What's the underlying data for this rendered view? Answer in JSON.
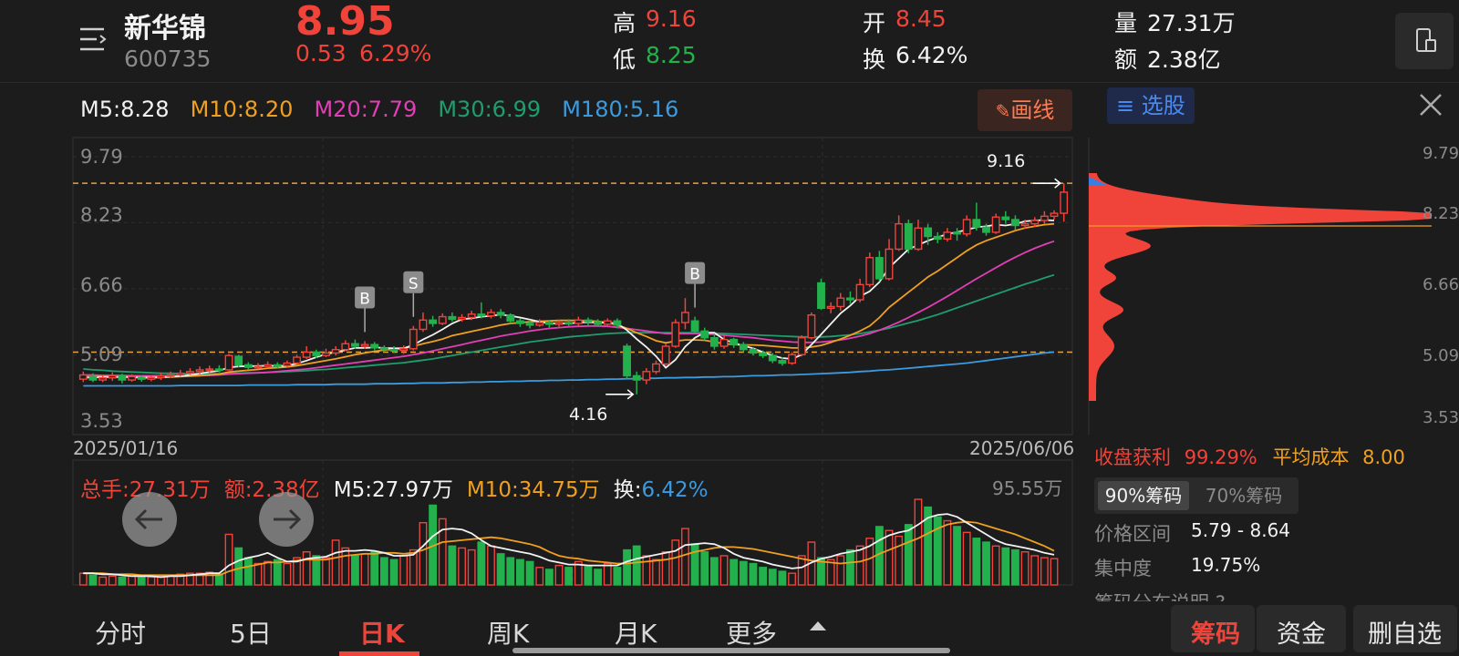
{
  "stock": {
    "name": "新华锦",
    "code": "600735",
    "price": "8.95",
    "change": "0.53",
    "change_pct": "6.29%",
    "high_label": "高",
    "high": "9.16",
    "low_label": "低",
    "low": "8.25",
    "open_label": "开",
    "open": "8.45",
    "turnover_label": "换",
    "turnover": "6.42%",
    "volume_label": "量",
    "volume": "27.31万",
    "amount_label": "额",
    "amount": "2.38亿"
  },
  "ma_legend": {
    "m5": "M5:8.28",
    "m10": "M10:8.20",
    "m20": "M20:7.79",
    "m30": "M30:6.99",
    "m180": "M180:5.16"
  },
  "draw_button": "画线",
  "chart_data": {
    "type": "candlestick",
    "y_ticks": [
      "9.79",
      "8.23",
      "6.66",
      "5.09",
      "3.53"
    ],
    "ylim": [
      3.53,
      9.79
    ],
    "date_start": "2025/01/16",
    "date_end": "2025/06/06",
    "max_annotation": "9.16",
    "min_annotation": "4.16",
    "max_value": 9.16,
    "min_value": 4.16,
    "ref_lines": [
      9.16,
      5.16
    ],
    "markers": [
      {
        "label": "B",
        "index": 29
      },
      {
        "label": "S",
        "index": 34
      },
      {
        "label": "B",
        "index": 63
      }
    ],
    "candles": [
      [
        4.52,
        4.62,
        4.7,
        4.45
      ],
      [
        4.58,
        4.5,
        4.66,
        4.45
      ],
      [
        4.5,
        4.55,
        4.62,
        4.45
      ],
      [
        4.55,
        4.6,
        4.68,
        4.48
      ],
      [
        4.6,
        4.5,
        4.65,
        4.42
      ],
      [
        4.5,
        4.58,
        4.64,
        4.46
      ],
      [
        4.56,
        4.52,
        4.62,
        4.46
      ],
      [
        4.52,
        4.56,
        4.62,
        4.47
      ],
      [
        4.56,
        4.6,
        4.68,
        4.5
      ],
      [
        4.6,
        4.62,
        4.7,
        4.55
      ],
      [
        4.62,
        4.66,
        4.74,
        4.58
      ],
      [
        4.66,
        4.7,
        4.78,
        4.62
      ],
      [
        4.7,
        4.74,
        4.82,
        4.64
      ],
      [
        4.74,
        4.76,
        4.84,
        4.68
      ],
      [
        4.76,
        4.74,
        4.85,
        4.68
      ],
      [
        4.74,
        5.08,
        5.12,
        4.72
      ],
      [
        5.06,
        4.86,
        5.1,
        4.8
      ],
      [
        4.86,
        4.8,
        4.92,
        4.74
      ],
      [
        4.8,
        4.82,
        4.9,
        4.76
      ],
      [
        4.82,
        4.86,
        4.94,
        4.78
      ],
      [
        4.86,
        4.84,
        4.92,
        4.78
      ],
      [
        4.84,
        4.9,
        4.96,
        4.8
      ],
      [
        4.9,
        5.04,
        5.1,
        4.86
      ],
      [
        5.04,
        5.16,
        5.3,
        5.0
      ],
      [
        5.16,
        5.08,
        5.22,
        5.02
      ],
      [
        5.08,
        5.14,
        5.24,
        5.04
      ],
      [
        5.14,
        5.22,
        5.3,
        5.08
      ],
      [
        5.22,
        5.36,
        5.44,
        5.18
      ],
      [
        5.36,
        5.3,
        5.46,
        5.24
      ],
      [
        5.3,
        5.34,
        5.42,
        5.24
      ],
      [
        5.34,
        5.26,
        5.4,
        5.2
      ],
      [
        5.26,
        5.22,
        5.32,
        5.16
      ],
      [
        5.22,
        5.2,
        5.3,
        5.14
      ],
      [
        5.2,
        5.24,
        5.32,
        5.12
      ],
      [
        5.24,
        5.7,
        5.78,
        5.2
      ],
      [
        5.7,
        5.92,
        6.1,
        5.64
      ],
      [
        5.92,
        5.84,
        6.02,
        5.76
      ],
      [
        5.84,
        6.0,
        6.08,
        5.8
      ],
      [
        6.0,
        5.94,
        6.1,
        5.88
      ],
      [
        5.94,
        5.98,
        6.06,
        5.88
      ],
      [
        5.98,
        6.06,
        6.14,
        5.92
      ],
      [
        6.06,
        6.02,
        6.34,
        5.96
      ],
      [
        6.02,
        6.1,
        6.18,
        5.96
      ],
      [
        6.1,
        6.04,
        6.18,
        5.96
      ],
      [
        6.04,
        5.9,
        6.08,
        5.84
      ],
      [
        5.9,
        5.84,
        5.96,
        5.76
      ],
      [
        5.84,
        5.8,
        5.92,
        5.72
      ],
      [
        5.8,
        5.86,
        5.94,
        5.76
      ],
      [
        5.86,
        5.82,
        5.92,
        5.74
      ],
      [
        5.82,
        5.86,
        5.92,
        5.76
      ],
      [
        5.86,
        5.84,
        5.94,
        5.78
      ],
      [
        5.84,
        5.92,
        6.0,
        5.78
      ],
      [
        5.92,
        5.88,
        5.98,
        5.8
      ],
      [
        5.88,
        5.82,
        5.94,
        5.76
      ],
      [
        5.82,
        5.9,
        5.96,
        5.78
      ],
      [
        5.9,
        5.8,
        5.96,
        5.72
      ],
      [
        5.3,
        4.6,
        5.36,
        4.52
      ],
      [
        4.6,
        4.5,
        4.7,
        4.16
      ],
      [
        4.5,
        4.7,
        4.78,
        4.4
      ],
      [
        4.7,
        4.88,
        4.96,
        4.64
      ],
      [
        4.88,
        5.3,
        5.36,
        4.84
      ],
      [
        5.3,
        5.86,
        5.94,
        5.26
      ],
      [
        5.86,
        6.1,
        6.44,
        5.7
      ],
      [
        5.9,
        5.66,
        6.0,
        5.6
      ],
      [
        5.66,
        5.5,
        5.74,
        5.44
      ],
      [
        5.5,
        5.3,
        5.6,
        5.22
      ],
      [
        5.3,
        5.46,
        5.56,
        5.24
      ],
      [
        5.46,
        5.34,
        5.5,
        5.26
      ],
      [
        5.34,
        5.22,
        5.4,
        5.16
      ],
      [
        5.22,
        5.14,
        5.28,
        5.08
      ],
      [
        5.14,
        5.08,
        5.2,
        5.02
      ],
      [
        5.08,
        4.96,
        5.14,
        4.9
      ],
      [
        4.96,
        4.9,
        5.04,
        4.84
      ],
      [
        4.9,
        5.1,
        5.16,
        4.86
      ],
      [
        5.1,
        5.5,
        5.56,
        5.06
      ],
      [
        5.5,
        6.04,
        6.1,
        5.46
      ],
      [
        6.8,
        6.2,
        6.9,
        6.16
      ],
      [
        6.2,
        6.24,
        6.34,
        6.08
      ],
      [
        6.24,
        6.44,
        6.56,
        6.14
      ],
      [
        6.44,
        6.4,
        6.6,
        6.3
      ],
      [
        6.4,
        6.76,
        6.9,
        6.34
      ],
      [
        6.76,
        7.4,
        7.52,
        6.7
      ],
      [
        7.4,
        6.9,
        7.56,
        6.84
      ],
      [
        6.9,
        7.6,
        7.84,
        6.86
      ],
      [
        7.6,
        8.2,
        8.4,
        7.56
      ],
      [
        8.2,
        7.6,
        8.3,
        7.5
      ],
      [
        7.6,
        8.1,
        8.3,
        7.56
      ],
      [
        8.1,
        7.9,
        8.2,
        7.7
      ],
      [
        7.9,
        7.84,
        8.0,
        7.74
      ],
      [
        7.84,
        8.0,
        8.1,
        7.78
      ],
      [
        8.0,
        7.96,
        8.1,
        7.8
      ],
      [
        7.96,
        8.3,
        8.4,
        7.9
      ],
      [
        8.3,
        8.12,
        8.7,
        8.04
      ],
      [
        8.12,
        8.0,
        8.2,
        7.92
      ],
      [
        8.0,
        8.36,
        8.44,
        7.96
      ],
      [
        8.36,
        8.3,
        8.5,
        8.2
      ],
      [
        8.3,
        8.16,
        8.4,
        8.06
      ],
      [
        8.16,
        8.2,
        8.3,
        8.08
      ],
      [
        8.2,
        8.28,
        8.36,
        8.12
      ],
      [
        8.28,
        8.38,
        8.5,
        8.2
      ],
      [
        8.38,
        8.45,
        8.52,
        8.3
      ],
      [
        8.45,
        8.95,
        9.16,
        8.25
      ]
    ],
    "ma5": [
      4.56,
      4.56,
      4.57,
      4.57,
      4.57,
      4.57,
      4.55,
      4.56,
      4.56,
      4.58,
      4.59,
      4.62,
      4.65,
      4.69,
      4.72,
      4.8,
      4.82,
      4.83,
      4.83,
      4.84,
      4.83,
      4.84,
      4.89,
      4.96,
      5.04,
      5.11,
      5.16,
      5.21,
      5.26,
      5.26,
      5.27,
      5.26,
      5.25,
      5.25,
      5.33,
      5.46,
      5.57,
      5.7,
      5.84,
      5.94,
      5.96,
      6.0,
      6.02,
      6.05,
      6.02,
      5.98,
      5.93,
      5.88,
      5.84,
      5.84,
      5.84,
      5.86,
      5.87,
      5.86,
      5.86,
      5.84,
      5.68,
      5.47,
      5.28,
      5.06,
      4.79,
      4.98,
      5.29,
      5.5,
      5.62,
      5.62,
      5.46,
      5.38,
      5.31,
      5.25,
      5.16,
      5.08,
      5.02,
      5.0,
      5.1,
      5.34,
      5.58,
      5.83,
      6.08,
      6.26,
      6.48,
      6.6,
      6.82,
      7.16,
      7.38,
      7.6,
      7.7,
      7.8,
      7.88,
      7.96,
      8.0,
      8.06,
      8.12,
      8.14,
      8.18,
      8.16,
      8.2,
      8.26,
      8.28,
      8.29,
      8.28
    ],
    "ma10": [
      4.58,
      4.58,
      4.58,
      4.58,
      4.57,
      4.57,
      4.57,
      4.57,
      4.57,
      4.57,
      4.58,
      4.59,
      4.6,
      4.62,
      4.64,
      4.69,
      4.71,
      4.73,
      4.75,
      4.78,
      4.79,
      4.81,
      4.84,
      4.88,
      4.92,
      4.96,
      5.0,
      5.05,
      5.1,
      5.14,
      5.18,
      5.21,
      5.23,
      5.25,
      5.3,
      5.36,
      5.41,
      5.47,
      5.55,
      5.6,
      5.65,
      5.7,
      5.75,
      5.8,
      5.84,
      5.86,
      5.88,
      5.89,
      5.9,
      5.91,
      5.91,
      5.91,
      5.9,
      5.89,
      5.86,
      5.8,
      5.72,
      5.62,
      5.53,
      5.43,
      5.38,
      5.42,
      5.45,
      5.45,
      5.44,
      5.4,
      5.36,
      5.34,
      5.33,
      5.33,
      5.32,
      5.3,
      5.28,
      5.26,
      5.26,
      5.28,
      5.32,
      5.39,
      5.47,
      5.56,
      5.66,
      5.78,
      5.98,
      6.22,
      6.4,
      6.58,
      6.76,
      6.94,
      7.08,
      7.24,
      7.4,
      7.56,
      7.7,
      7.8,
      7.88,
      7.96,
      8.04,
      8.1,
      8.14,
      8.18,
      8.2
    ],
    "ma20": [
      4.62,
      4.62,
      4.61,
      4.61,
      4.61,
      4.6,
      4.6,
      4.6,
      4.6,
      4.6,
      4.6,
      4.6,
      4.61,
      4.61,
      4.62,
      4.64,
      4.65,
      4.66,
      4.67,
      4.68,
      4.7,
      4.72,
      4.74,
      4.76,
      4.79,
      4.82,
      4.85,
      4.88,
      4.91,
      4.94,
      4.97,
      5.0,
      5.03,
      5.06,
      5.1,
      5.14,
      5.19,
      5.24,
      5.29,
      5.34,
      5.39,
      5.44,
      5.49,
      5.54,
      5.58,
      5.62,
      5.66,
      5.69,
      5.72,
      5.74,
      5.76,
      5.77,
      5.78,
      5.78,
      5.77,
      5.75,
      5.72,
      5.69,
      5.66,
      5.63,
      5.6,
      5.6,
      5.6,
      5.6,
      5.59,
      5.58,
      5.56,
      5.54,
      5.52,
      5.5,
      5.47,
      5.44,
      5.42,
      5.4,
      5.39,
      5.39,
      5.4,
      5.42,
      5.45,
      5.49,
      5.54,
      5.6,
      5.68,
      5.77,
      5.87,
      5.98,
      6.1,
      6.22,
      6.35,
      6.48,
      6.62,
      6.76,
      6.9,
      7.03,
      7.16,
      7.29,
      7.41,
      7.52,
      7.62,
      7.71,
      7.79
    ],
    "ma30": [
      4.76,
      4.74,
      4.73,
      4.71,
      4.7,
      4.69,
      4.68,
      4.67,
      4.66,
      4.66,
      4.65,
      4.65,
      4.65,
      4.65,
      4.65,
      4.66,
      4.66,
      4.67,
      4.67,
      4.68,
      4.69,
      4.7,
      4.71,
      4.72,
      4.74,
      4.75,
      4.77,
      4.79,
      4.81,
      4.83,
      4.85,
      4.87,
      4.89,
      4.91,
      4.94,
      4.97,
      5.0,
      5.04,
      5.08,
      5.12,
      5.16,
      5.2,
      5.24,
      5.28,
      5.32,
      5.36,
      5.4,
      5.43,
      5.46,
      5.49,
      5.52,
      5.54,
      5.56,
      5.58,
      5.6,
      5.61,
      5.62,
      5.62,
      5.62,
      5.62,
      5.62,
      5.62,
      5.62,
      5.62,
      5.62,
      5.61,
      5.6,
      5.59,
      5.58,
      5.57,
      5.56,
      5.55,
      5.54,
      5.53,
      5.52,
      5.52,
      5.52,
      5.53,
      5.55,
      5.57,
      5.6,
      5.64,
      5.68,
      5.73,
      5.79,
      5.85,
      5.91,
      5.98,
      6.05,
      6.13,
      6.21,
      6.29,
      6.37,
      6.45,
      6.53,
      6.61,
      6.69,
      6.77,
      6.84,
      6.92,
      6.99
    ],
    "ma180": [
      4.36,
      4.36,
      4.36,
      4.36,
      4.36,
      4.36,
      4.36,
      4.36,
      4.36,
      4.36,
      4.37,
      4.37,
      4.37,
      4.37,
      4.37,
      4.37,
      4.37,
      4.38,
      4.38,
      4.38,
      4.38,
      4.38,
      4.39,
      4.39,
      4.39,
      4.39,
      4.4,
      4.4,
      4.4,
      4.4,
      4.41,
      4.41,
      4.41,
      4.42,
      4.42,
      4.43,
      4.43,
      4.43,
      4.44,
      4.44,
      4.45,
      4.45,
      4.46,
      4.46,
      4.47,
      4.47,
      4.48,
      4.48,
      4.49,
      4.49,
      4.5,
      4.5,
      4.51,
      4.51,
      4.52,
      4.52,
      4.53,
      4.53,
      4.54,
      4.54,
      4.55,
      4.55,
      4.56,
      4.56,
      4.57,
      4.57,
      4.58,
      4.58,
      4.59,
      4.6,
      4.6,
      4.61,
      4.62,
      4.62,
      4.63,
      4.64,
      4.65,
      4.66,
      4.67,
      4.68,
      4.7,
      4.71,
      4.73,
      4.74,
      4.76,
      4.78,
      4.8,
      4.82,
      4.84,
      4.86,
      4.88,
      4.9,
      4.93,
      4.96,
      4.99,
      5.02,
      5.05,
      5.08,
      5.11,
      5.14,
      5.16
    ]
  },
  "volume": {
    "total_label": "总手:27.31万",
    "amount_label": "额:2.38亿",
    "m5_label": "M5:27.97万",
    "m10_label": "M10:34.75万",
    "turnover_prefix": "换:",
    "turnover_value": "6.42%",
    "max_label": "95.55万",
    "max": 95.55,
    "values": [
      12,
      10,
      8,
      9,
      8,
      9,
      8,
      8,
      9,
      10,
      11,
      12,
      12,
      13,
      11,
      52,
      38,
      28,
      22,
      24,
      26,
      22,
      28,
      34,
      30,
      28,
      46,
      38,
      30,
      32,
      34,
      28,
      26,
      30,
      36,
      64,
      82,
      68,
      40,
      38,
      36,
      44,
      40,
      32,
      28,
      26,
      24,
      18,
      16,
      20,
      18,
      24,
      20,
      16,
      22,
      18,
      36,
      40,
      30,
      26,
      34,
      46,
      58,
      42,
      34,
      28,
      30,
      26,
      24,
      22,
      18,
      16,
      14,
      12,
      30,
      44,
      28,
      26,
      30,
      36,
      40,
      48,
      60,
      56,
      50,
      62,
      88,
      80,
      70,
      66,
      60,
      54,
      48,
      44,
      40,
      38,
      36,
      34,
      30,
      28,
      27
    ],
    "ma5": [
      12,
      12,
      11,
      11,
      10,
      9,
      9,
      9,
      8,
      9,
      9,
      10,
      11,
      12,
      12,
      20,
      25,
      28,
      30,
      33,
      28,
      24,
      24,
      27,
      28,
      29,
      33,
      35,
      35,
      36,
      35,
      33,
      30,
      30,
      31,
      40,
      50,
      57,
      58,
      57,
      53,
      46,
      40,
      38,
      36,
      34,
      32,
      29,
      25,
      23,
      21,
      21,
      20,
      20,
      20,
      20,
      24,
      27,
      29,
      31,
      33,
      35,
      41,
      42,
      43,
      42,
      38,
      32,
      28,
      26,
      24,
      21,
      19,
      17,
      18,
      23,
      27,
      29,
      32,
      34,
      36,
      40,
      46,
      51,
      54,
      56,
      62,
      69,
      72,
      73,
      70,
      64,
      58,
      52,
      46,
      42,
      40,
      38,
      36,
      33,
      31
    ],
    "ma10": [
      12,
      12,
      12,
      11,
      11,
      11,
      10,
      10,
      10,
      10,
      10,
      10,
      10,
      10,
      10,
      14,
      17,
      19,
      21,
      23,
      23,
      24,
      25,
      26,
      26,
      26,
      28,
      30,
      31,
      32,
      32,
      33,
      33,
      32,
      33,
      36,
      40,
      44,
      45,
      46,
      47,
      48,
      49,
      48,
      46,
      44,
      42,
      39,
      34,
      30,
      28,
      27,
      25,
      24,
      23,
      22,
      22,
      23,
      24,
      25,
      26,
      28,
      31,
      34,
      36,
      38,
      39,
      39,
      38,
      37,
      35,
      33,
      31,
      29,
      27,
      25,
      24,
      23,
      22,
      23,
      24,
      27,
      32,
      36,
      40,
      44,
      48,
      53,
      58,
      62,
      64,
      65,
      64,
      61,
      58,
      55,
      52,
      48,
      44,
      40,
      35
    ]
  },
  "chip_panel": {
    "title": "选股",
    "y_ticks": [
      "9.79",
      "8.23",
      "6.66",
      "5.09",
      "3.53"
    ],
    "profit_label": "收盘获利",
    "profit_value": "99.29%",
    "avg_cost_label": "平均成本",
    "avg_cost_value": "8.00",
    "tab_90": "90%筹码",
    "tab_70": "70%筹码",
    "range_label": "价格区间",
    "range_value": "5.79 - 8.64",
    "concentration_label": "集中度",
    "concentration_value": "19.75%",
    "explain_label": "筹码分布说明"
  },
  "bottom_tabs": [
    "分时",
    "5日",
    "日K",
    "周K",
    "月K",
    "更多"
  ],
  "bottom_buttons": [
    "筹码",
    "资金",
    "删自选"
  ]
}
